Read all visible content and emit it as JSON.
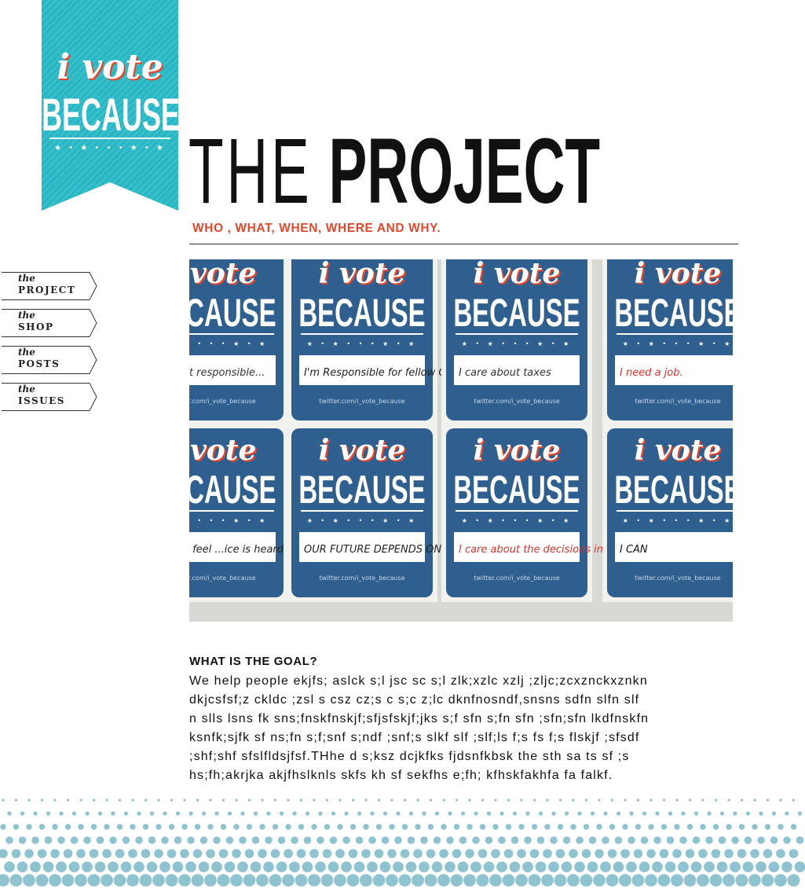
{
  "logo": {
    "line1": "i vote",
    "line2": "BECAUSE",
    "stars": "★ • ★ • • • ★ • ★",
    "bg_color": "#2ab6c3",
    "accent_color": "#e4482c"
  },
  "nav": {
    "items": [
      {
        "small": "the",
        "big": "PROJECT"
      },
      {
        "small": "the",
        "big": "SHOP"
      },
      {
        "small": "the",
        "big": "POSTS"
      },
      {
        "small": "the",
        "big": "ISSUES"
      }
    ]
  },
  "header": {
    "title_light": "THE",
    "title_bold": "PROJECT",
    "subtitle": "WHO , WHAT, WHEN, WHERE AND WHY."
  },
  "photo": {
    "posters": [
      {
        "line1": "i vote",
        "line2": "BECAUSE",
        "note": "to elect responsible...",
        "twitter": "twitter.com/i_vote_because"
      },
      {
        "line1": "i vote",
        "line2": "BECAUSE",
        "note": "I'm Responsible for fellow CITIZENS",
        "twitter": "twitter.com/i_vote_because"
      },
      {
        "line1": "i vote",
        "line2": "BECAUSE",
        "note": "I care about taxes",
        "twitter": "twitter.com/i_vote_because"
      },
      {
        "line1": "i vote",
        "line2": "BECAUSE",
        "note": "I need a job.",
        "twitter": "twitter.com/i_vote_because"
      },
      {
        "line1": "i vote",
        "line2": "BECAUSE",
        "note": "...s me feel ...ice is heard",
        "twitter": "twitter.com/i_vote_because"
      },
      {
        "line1": "i vote",
        "line2": "BECAUSE",
        "note": "OUR FUTURE DEPENDS ON IT",
        "twitter": "twitter.com/i_vote_because"
      },
      {
        "line1": "i vote",
        "line2": "BECAUSE",
        "note": "I care about the decisions in gov.",
        "twitter": "twitter.com/i_vote_because"
      },
      {
        "line1": "i vote",
        "line2": "BECAUSE",
        "note": "I CAN",
        "twitter": "twitter.com/i_vote_because"
      }
    ],
    "poster_color": "#2f5f8f",
    "note_colors": [
      "#333333",
      "#222222",
      "#333333",
      "#d8322a",
      "#222222",
      "#222222",
      "#d8322a",
      "#111111"
    ]
  },
  "goal": {
    "heading": "WHAT IS THE GOAL?",
    "lines": [
      "We help people ekjfs; aslck s;l jsc sc s;l zlk;xzlc xzlj ;zljc;zcxznckxznkn",
      "dkjcsfsf;z ckldc ;zsl s csz cz;s c s;c z;lc  dknfnosndf,snsns sdfn slfn slf",
      "n slls lsns fk sns;fnskfnskjf;sfjsfskjf;jks s;f sfn s;fn sfn ;sfn;sfn lkdfnskfn",
      "ksnfk;sjfk sf ns;fn s;f;snf s;ndf ;snf;s slkf slf ;slf;ls f;s fs f;s flskjf ;sfsdf",
      ";shf;shf sfslfldsjfsf.THhe d s;ksz dcjkfks fjdsnfkbsk the sth sa ts sf ;s",
      "hs;fh;akrjka akjfhslknls  skfs kh  sf sekfhs e;fh; kfhskfakhfa fa falkf."
    ]
  },
  "dots_color": "#8fc3cf"
}
